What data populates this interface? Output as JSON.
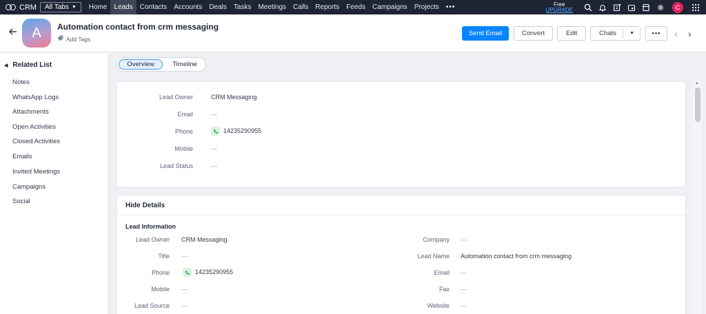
{
  "nav": {
    "brand": "CRM",
    "all_tabs": "All Tabs",
    "tabs": [
      "Home",
      "Leads",
      "Contacts",
      "Accounts",
      "Deals",
      "Tasks",
      "Meetings",
      "Calls",
      "Reports",
      "Feeds",
      "Campaigns",
      "Projects"
    ],
    "more": "•••",
    "free_label": "Free",
    "upgrade_label": "UPGRADE",
    "avatar_letter": "C"
  },
  "header": {
    "avatar_letter": "A",
    "title": "Automation contact from crm messaging",
    "add_tags": "Add Tags",
    "buttons": {
      "send_email": "Send Email",
      "convert": "Convert",
      "edit": "Edit",
      "chats": "Chats",
      "more": "•••"
    }
  },
  "sidebar": {
    "title": "Related List",
    "items": [
      "Notes",
      "WhatsApp Logs",
      "Attachments",
      "Open Activities",
      "Closed Activities",
      "Emails",
      "Invited Meetings",
      "Campaigns",
      "Social"
    ]
  },
  "view_tabs": {
    "overview": "Overview",
    "timeline": "Timeline"
  },
  "overview": {
    "lead_owner_label": "Lead Owner",
    "lead_owner": "CRM Messaging",
    "email_label": "Email",
    "email": "—",
    "phone_label": "Phone",
    "phone": "14235290955",
    "mobile_label": "Mobile",
    "mobile": "—",
    "lead_status_label": "Lead Status",
    "lead_status": "—"
  },
  "details": {
    "hide_details": "Hide Details",
    "section_title": "Lead Information",
    "left": {
      "lead_owner_label": "Lead Owner",
      "lead_owner": "CRM Messaging",
      "title_label": "Title",
      "title": "—",
      "phone_label": "Phone",
      "phone": "14235290955",
      "mobile_label": "Mobile",
      "mobile": "—",
      "lead_source_label": "Lead Source",
      "lead_source": "—"
    },
    "right": {
      "company_label": "Company",
      "company": "—",
      "lead_name_label": "Lead Name",
      "lead_name": "Automation contact from crm messaging",
      "email_label": "Email",
      "email": "—",
      "fax_label": "Fax",
      "fax": "—",
      "website_label": "Website",
      "website": "—"
    }
  },
  "colors": {
    "nav_bg": "#1d2433",
    "primary": "#0a84ff",
    "avatar_small": "#e0245e"
  }
}
